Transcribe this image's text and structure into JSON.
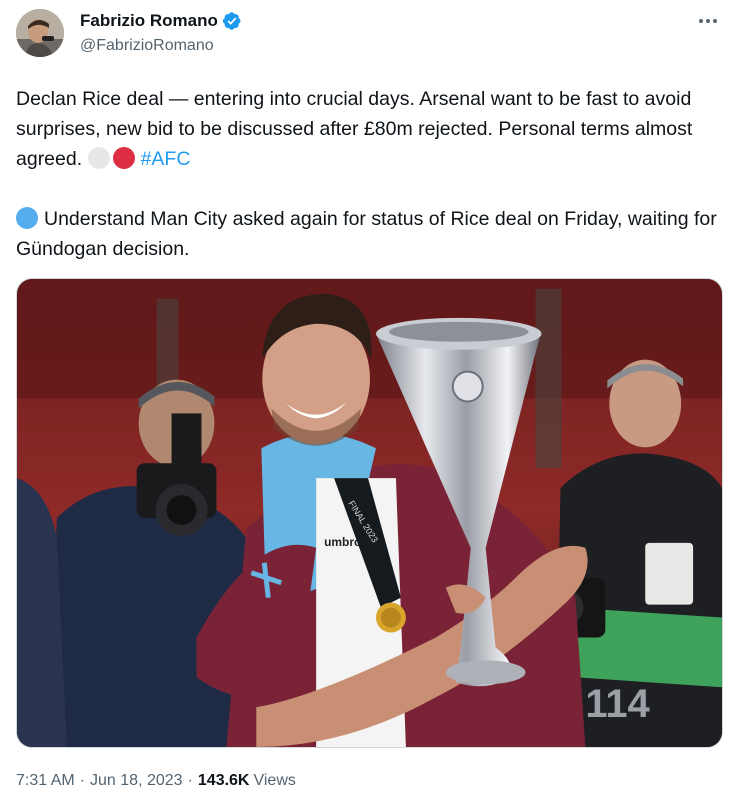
{
  "author": {
    "display_name": "Fabrizio Romano",
    "handle": "@FabrizioRomano",
    "verified": true,
    "avatar_icon": "profile-photo"
  },
  "tweet": {
    "paragraph1": "Declan Rice deal — entering into crucial days. Arsenal want to be fast to avoid surprises, new bid to be discussed after £80m rejected. Personal terms almost agreed.",
    "paragraph1_emojis": [
      "white-circle-icon",
      "red-circle-icon"
    ],
    "hashtag": "#AFC",
    "paragraph2": "Understand Man City asked again for status of Rice deal on Friday, waiting for Gündogan decision.",
    "paragraph2_emoji": "blue-circle-icon"
  },
  "media": {
    "photo_text": {
      "shirt_brand": "umbro",
      "lanyard_text": "FINAL 2023",
      "bib_number": "114"
    }
  },
  "meta": {
    "time": "7:31 AM",
    "date": "Jun 18, 2023",
    "views_count": "143.6K",
    "views_label": "Views"
  },
  "colors": {
    "text": "#0f1419",
    "secondary": "#536471",
    "link": "#1d9bf0",
    "verified": "#1d9bf0"
  }
}
